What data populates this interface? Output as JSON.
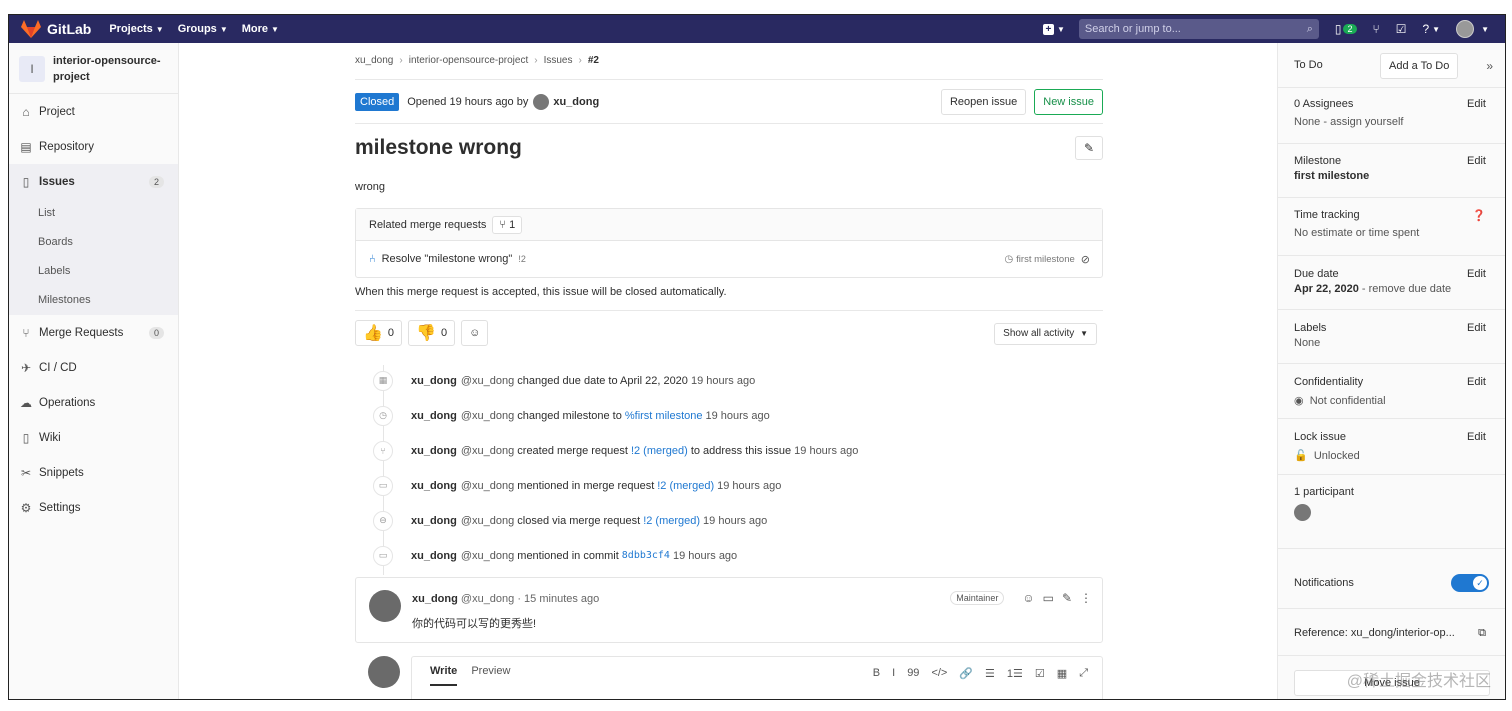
{
  "navbar": {
    "brand": "GitLab",
    "menu": [
      "Projects",
      "Groups",
      "More"
    ],
    "search_placeholder": "Search or jump to...",
    "todo_badge": "2"
  },
  "sidebar": {
    "project_initial": "I",
    "project_name": "interior-opensource-project",
    "items": {
      "project": "Project",
      "repository": "Repository",
      "issues": "Issues",
      "issues_count": "2",
      "merge_requests": "Merge Requests",
      "mr_count": "0",
      "cicd": "CI / CD",
      "operations": "Operations",
      "wiki": "Wiki",
      "snippets": "Snippets",
      "settings": "Settings"
    },
    "issues_sub": [
      "List",
      "Boards",
      "Labels",
      "Milestones"
    ]
  },
  "breadcrumb": [
    "xu_dong",
    "interior-opensource-project",
    "Issues",
    "#2"
  ],
  "issue": {
    "status": "Closed",
    "opened_text": "Opened 19 hours ago by",
    "author": "xu_dong",
    "reopen_label": "Reopen issue",
    "new_issue_label": "New issue",
    "title": "milestone wrong",
    "description": "wrong"
  },
  "related_mr": {
    "header": "Related merge requests",
    "count": "1",
    "item_title": "Resolve \"milestone wrong\"",
    "item_ref": "!2",
    "item_milestone": "first milestone",
    "auto_close": "When this merge request is accepted, this issue will be closed automatically."
  },
  "awards": {
    "thumbs_up": "0",
    "thumbs_down": "0",
    "activity_filter": "Show all activity"
  },
  "notes": [
    {
      "user": "xu_dong",
      "handle": "@xu_dong",
      "text": "changed due date to April 22, 2020",
      "link": "",
      "extra": "",
      "time": "19 hours ago"
    },
    {
      "user": "xu_dong",
      "handle": "@xu_dong",
      "text": "changed milestone to",
      "link": "%first milestone",
      "extra": "",
      "time": "19 hours ago"
    },
    {
      "user": "xu_dong",
      "handle": "@xu_dong",
      "text": "created merge request",
      "link": "!2 (merged)",
      "extra": "to address this issue",
      "time": "19 hours ago"
    },
    {
      "user": "xu_dong",
      "handle": "@xu_dong",
      "text": "mentioned in merge request",
      "link": "!2 (merged)",
      "extra": "",
      "time": "19 hours ago"
    },
    {
      "user": "xu_dong",
      "handle": "@xu_dong",
      "text": "closed via merge request",
      "link": "!2 (merged)",
      "extra": "",
      "time": "19 hours ago"
    },
    {
      "user": "xu_dong",
      "handle": "@xu_dong",
      "text": "mentioned in commit",
      "link": "8dbb3cf4",
      "extra": "",
      "time": "19 hours ago"
    }
  ],
  "comment": {
    "user": "xu_dong",
    "meta": "@xu_dong · 15 minutes ago",
    "role": "Maintainer",
    "body": "你的代码可以写的更秀些!"
  },
  "editor": {
    "write": "Write",
    "preview": "Preview",
    "tools": [
      "B",
      "I",
      "99",
      "</>",
      "🔗",
      "☰",
      "1☰",
      "☑",
      "▦",
      "⤢"
    ]
  },
  "right": {
    "todo": "To Do",
    "add_todo": "Add a To Do",
    "assignees_title": "0 Assignees",
    "assignees_val": "None - assign yourself",
    "milestone_title": "Milestone",
    "milestone_val": "first milestone",
    "time_title": "Time tracking",
    "time_val": "No estimate or time spent",
    "due_title": "Due date",
    "due_val": "Apr 22, 2020",
    "due_remove": "- remove due date",
    "labels_title": "Labels",
    "labels_val": "None",
    "conf_title": "Confidentiality",
    "conf_val": "Not confidential",
    "lock_title": "Lock issue",
    "lock_val": "Unlocked",
    "participants": "1 participant",
    "notifications": "Notifications",
    "reference": "Reference: xu_dong/interior-op...",
    "move": "Move issue",
    "edit": "Edit"
  },
  "watermark": "@稀土掘金技术社区"
}
